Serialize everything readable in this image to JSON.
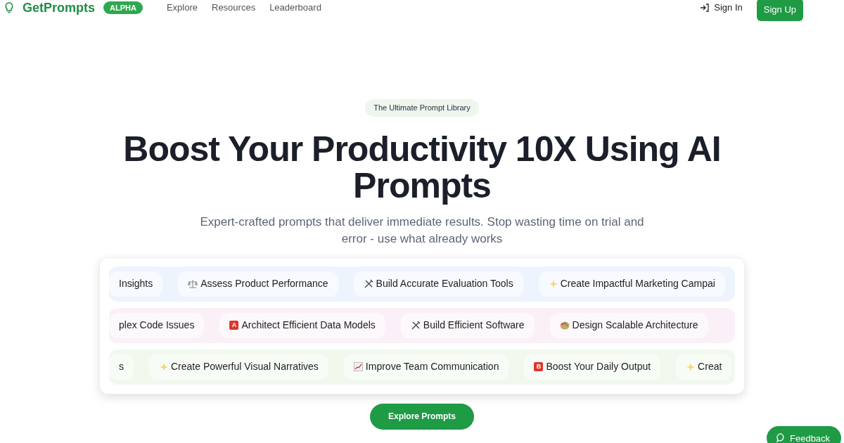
{
  "nav": {
    "brand": "GetPrompts",
    "badge": "ALPHA",
    "links": [
      "Explore",
      "Resources",
      "Leaderboard"
    ],
    "sign_in": "Sign In",
    "sign_up": "Sign Up"
  },
  "hero": {
    "tag": "The Ultimate Prompt Library",
    "title": "Boost Your Productivity 10X Using AI Prompts",
    "subtitle": "Expert-crafted prompts that deliver immediate results. Stop wasting time on trial and error - use what already works"
  },
  "marquee": [
    {
      "color": "#eef4fd",
      "chips": [
        {
          "kind": "plain",
          "label": "Insights"
        },
        {
          "kind": "balance",
          "label": "Assess Product Performance"
        },
        {
          "kind": "tools",
          "label": "Build Accurate Evaluation Tools"
        },
        {
          "kind": "sparkles",
          "label": "Create Impactful Marketing Campai"
        }
      ]
    },
    {
      "color": "#fbf0f7",
      "chips": [
        {
          "kind": "plain",
          "label": "plex Code Issues"
        },
        {
          "kind": "badge",
          "badge": "A",
          "label": "Architect Efficient Data Models"
        },
        {
          "kind": "tools",
          "label": "Build Efficient Software"
        },
        {
          "kind": "palette",
          "label": "Design Scalable Architecture"
        }
      ]
    },
    {
      "color": "#f1f9ef",
      "chips": [
        {
          "kind": "plain",
          "label": "s"
        },
        {
          "kind": "sparkles",
          "label": "Create Powerful Visual Narratives"
        },
        {
          "kind": "chart",
          "label": "Improve Team Communication"
        },
        {
          "kind": "badge",
          "badge": "B",
          "label": "Boost Your Daily Output"
        },
        {
          "kind": "sparkles",
          "label": "Creat"
        }
      ]
    }
  ],
  "cta": "Explore Prompts",
  "feedback": "Feedback"
}
